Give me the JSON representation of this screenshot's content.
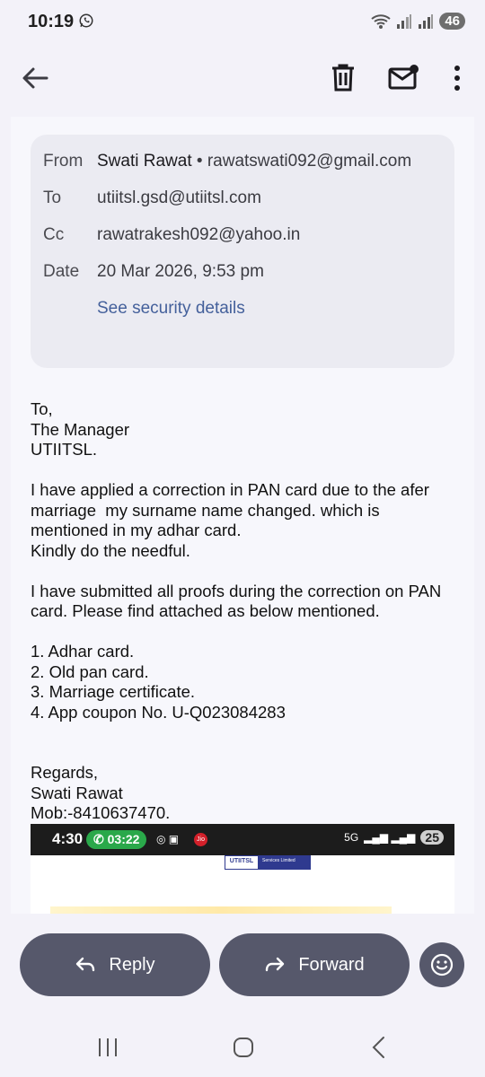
{
  "status_bar": {
    "time": "10:19",
    "battery": "46"
  },
  "email": {
    "from_label": "From",
    "from_name": "Swati Rawat",
    "from_sep": "•",
    "from_email": "rawatswati092@gmail.com",
    "to_label": "To",
    "to_value": "utiitsl.gsd@utiitsl.com",
    "cc_label": "Cc",
    "cc_value": "rawatrakesh092@yahoo.in",
    "date_label": "Date",
    "date_value": "20 Mar 2026, 9:53 pm",
    "security_link": "See security details",
    "body": "To,\nThe Manager\nUTIITSL.\n\nI have applied a correction in PAN card due to the afer marriage  my surname name changed. which is mentioned in my adhar card.\nKindly do the needful.\n\nI have submitted all proofs during the correction on PAN card. Please find attached as below mentioned.\n\n1. Adhar card.\n2. Old pan card.\n3. Marriage certificate.\n4. App coupon No. U-Q023084283\n\n\nRegards,\nSwati Rawat\nMob:-8410637470."
  },
  "embedded_screenshot": {
    "time": "4:30",
    "call_timer": "03:22",
    "carrier_badge": "Jio",
    "network": "5G",
    "battery": "25",
    "logo_left": "UTIITSL",
    "logo_right": "Services Limited"
  },
  "actions": {
    "reply": "Reply",
    "forward": "Forward"
  }
}
